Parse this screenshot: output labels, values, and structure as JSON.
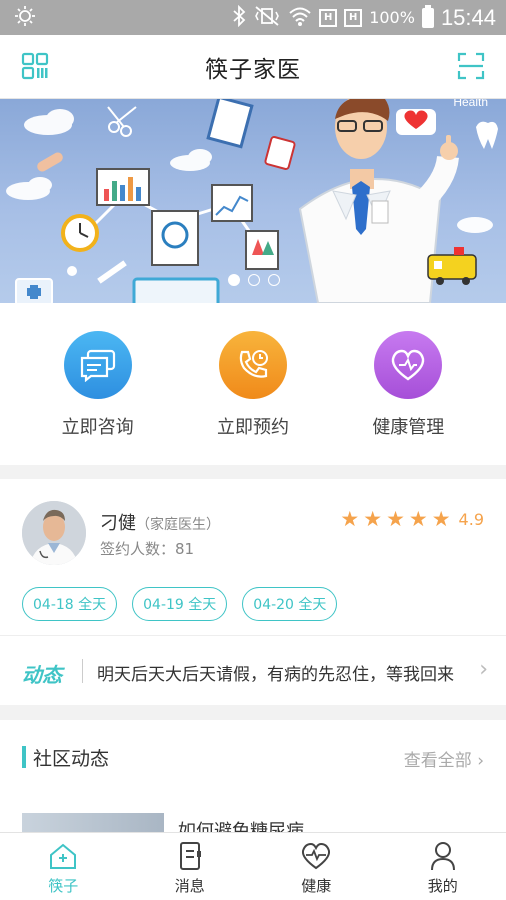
{
  "status_bar": {
    "battery": "100%",
    "time": "15:44",
    "sim1": "H",
    "sim2": "H"
  },
  "header": {
    "title": "筷子家医",
    "left_icon": "qr-code-icon",
    "right_icon": "scan-icon"
  },
  "banner": {
    "corner_text": "Health",
    "slide_count": 3,
    "active_slide": 1
  },
  "quick_actions": [
    {
      "label": "立即咨询",
      "icon": "chat-icon",
      "color": "#2e9fe8"
    },
    {
      "label": "立即预约",
      "icon": "phone-clock-icon",
      "color": "#f39a1f"
    },
    {
      "label": "健康管理",
      "icon": "heart-icon",
      "color": "#b65ee0"
    }
  ],
  "doctor": {
    "name": "刁健",
    "role": "（家庭医生）",
    "signed_label": "签约人数：81",
    "rating": "4.9",
    "stars": 5
  },
  "slots": [
    {
      "label": "04-18 全天"
    },
    {
      "label": "04-19 全天"
    },
    {
      "label": "04-20 全天"
    }
  ],
  "news": {
    "tag": "动态",
    "text": "明天后天大后天请假，有病的先忍住，等我回来"
  },
  "community": {
    "title": "社区动态",
    "more": "查看全部",
    "post_title": "如何避免糖尿病"
  },
  "tabs": [
    {
      "label": "筷子",
      "icon": "home-icon",
      "active": true
    },
    {
      "label": "消息",
      "icon": "message-icon",
      "active": false
    },
    {
      "label": "健康",
      "icon": "health-icon",
      "active": false
    },
    {
      "label": "我的",
      "icon": "profile-icon",
      "active": false
    }
  ],
  "colors": {
    "accent": "#3fc4c6",
    "star": "#f5a34c"
  }
}
